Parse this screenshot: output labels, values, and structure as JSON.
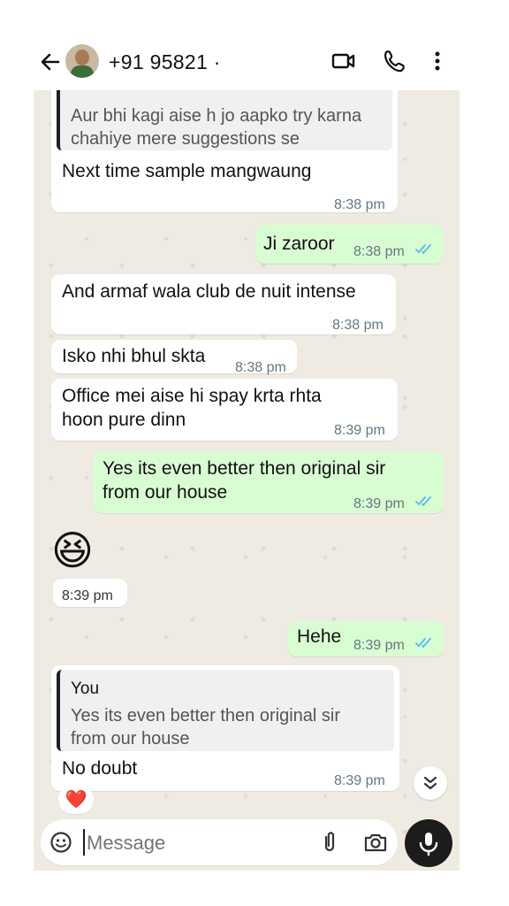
{
  "header": {
    "contact_name": "+91 95821 ·"
  },
  "messages": {
    "m1": {
      "quote_text": "Aur bhi kagi aise h jo aapko try karna chahiye mere suggestions se",
      "text": "Next time sample mangwaung",
      "time": "8:38 pm"
    },
    "m2": {
      "text": "Ji zaroor",
      "time": "8:38 pm"
    },
    "m3": {
      "text": "And armaf wala club de nuit intense",
      "time": "8:38 pm"
    },
    "m4": {
      "text": "Isko nhi bhul skta",
      "time": "8:38 pm"
    },
    "m5": {
      "line1": "Office mei aise hi spay krta rhta",
      "line2": "hoon pure dinn",
      "time": "8:39 pm"
    },
    "m6": {
      "line1": "Yes its even better then original sir",
      "line2": "from our house",
      "time": "8:39 pm"
    },
    "m7": {
      "emoji": "😆",
      "time": "8:39 pm"
    },
    "m8": {
      "text": "Hehe",
      "time": "8:39 pm"
    },
    "m9": {
      "quote_name": "You",
      "quote_line1": "Yes its even better then original sir",
      "quote_line2": "from our house",
      "text": "No doubt",
      "time": "8:39 pm",
      "reaction": "❤️"
    }
  },
  "composer": {
    "placeholder": "Message"
  },
  "colors": {
    "outgoing": "#d9fdd3",
    "incoming": "#ffffff",
    "read_ticks": "#53bdeb",
    "wallpaper": "#efeae2"
  },
  "icons": [
    "back-arrow-icon",
    "video-call-icon",
    "phone-icon",
    "more-vert-icon",
    "double-check-icon",
    "emoji-icon",
    "attach-icon",
    "camera-icon",
    "mic-icon",
    "scroll-down-icon"
  ]
}
